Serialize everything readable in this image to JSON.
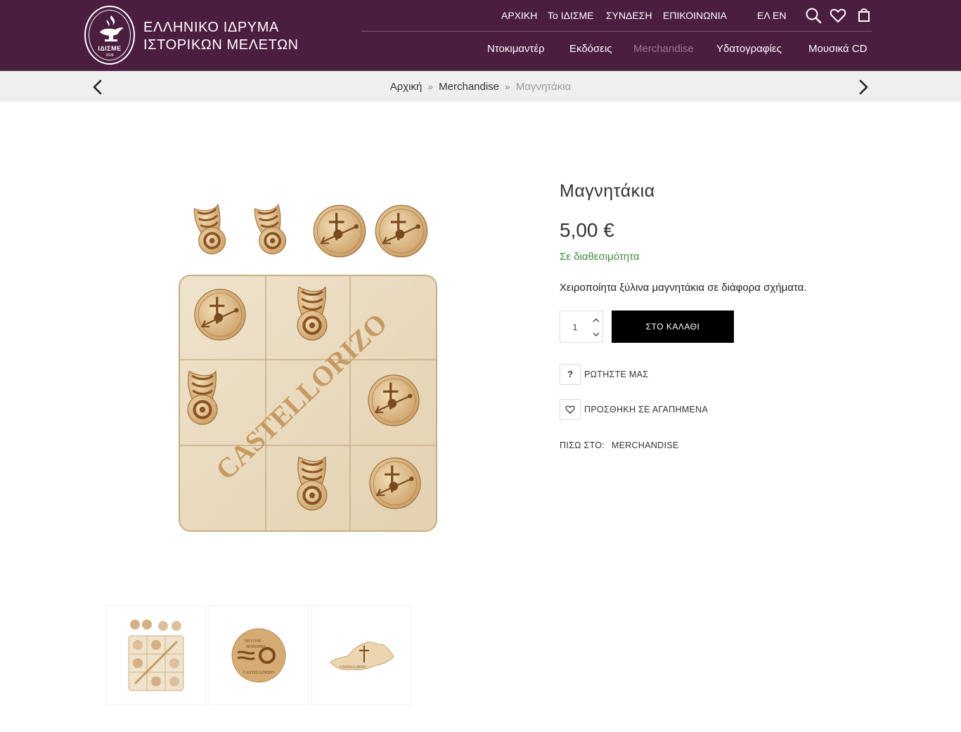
{
  "header": {
    "logo_text": "ΙΔΙΣΜΕ",
    "logo_year": "2008",
    "org_name_line1": "ΕΛΛΗΝΙΚΟ ΙΔΡΥΜΑ",
    "org_name_line2": "ΙΣΤΟΡΙΚΩΝ ΜΕΛΕΤΩΝ",
    "top_nav": [
      "ΑΡΧΙΚΗ",
      "Το ΙΔΙΣΜΕ",
      "ΣΥΝΔΕΣΗ",
      "ΕΠΙΚΟΙΝΩΝΙΑ"
    ],
    "lang": [
      "ΕΛ",
      "EN"
    ],
    "main_nav": [
      "Ντοκιμαντέρ",
      "Εκδόσεις",
      "Merchandise",
      "Υδατογραφίες",
      "Μουσικά CD"
    ],
    "active_nav": "Merchandise",
    "icons": [
      "search-icon",
      "heart-icon",
      "cart-icon"
    ],
    "brand_color": "#4b1d3f"
  },
  "breadcrumb": {
    "items": [
      "Αρχική",
      "Merchandise",
      "Μαγνητάκια"
    ]
  },
  "product": {
    "title": "Μαγνητάκια",
    "price": "5,00 €",
    "stock": "Σε διαθεσιμότητα",
    "description": "Χειροποίητα ξύλινα μαγνητάκια σε διάφορα σχήματα.",
    "quantity": "1",
    "add_to_cart": "ΣΤΟ ΚΑΛΑΘΙ",
    "ask_label": "ΡΩΤΗΣΤΕ ΜΑΣ",
    "ask_icon": "?",
    "wishlist_label": "ΠΡΟΣΘΗΚΗ ΣΕ ΑΓΑΠΗΜΕΝΑ",
    "back_label": "ΠΙΣΩ ΣΤΟ:",
    "back_link": "MERCHANDISE",
    "image_text": "CASTELLORIZO",
    "thumb2_text": [
      "NEVONE",
      "BORDERS",
      "CASTELLORIZO"
    ],
    "thumb3_text": "CASTELLORIZO",
    "stock_color": "#3f8a3f"
  }
}
